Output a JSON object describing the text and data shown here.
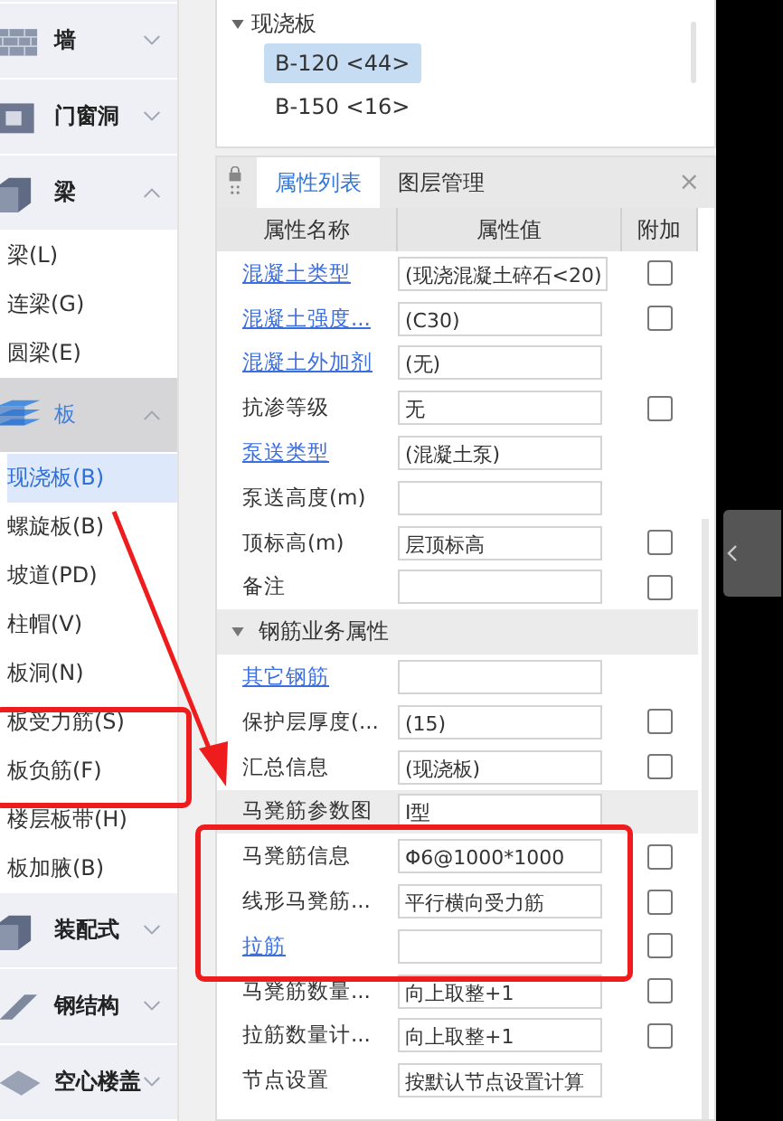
{
  "sidebar": {
    "groups": [
      {
        "label": "墙",
        "expanded": false,
        "selected": false
      },
      {
        "label": "门窗洞",
        "expanded": false,
        "selected": false
      },
      {
        "label": "梁",
        "expanded": true,
        "selected": false,
        "children": [
          {
            "label": "梁(L)",
            "selected": false
          },
          {
            "label": "连梁(G)",
            "selected": false
          },
          {
            "label": "圆梁(E)",
            "selected": false
          }
        ]
      },
      {
        "label": "板",
        "expanded": true,
        "selected": true,
        "children": [
          {
            "label": "现浇板(B)",
            "selected": true
          },
          {
            "label": "螺旋板(B)",
            "selected": false
          },
          {
            "label": "坡道(PD)",
            "selected": false
          },
          {
            "label": "柱帽(V)",
            "selected": false
          },
          {
            "label": "板洞(N)",
            "selected": false
          },
          {
            "label": "板受力筋(S)",
            "selected": false
          },
          {
            "label": "板负筋(F)",
            "selected": false
          },
          {
            "label": "楼层板带(H)",
            "selected": false
          },
          {
            "label": "板加腋(B)",
            "selected": false
          }
        ]
      },
      {
        "label": "装配式",
        "expanded": false,
        "selected": false
      },
      {
        "label": "钢结构",
        "expanded": false,
        "selected": false
      },
      {
        "label": "空心楼盖",
        "expanded": false,
        "selected": false
      }
    ]
  },
  "tree": {
    "label": "现浇板",
    "expanded": true,
    "items": [
      {
        "label": "B-120 <44>",
        "selected": true
      },
      {
        "label": "B-150 <16>",
        "selected": false
      }
    ]
  },
  "tabs": [
    {
      "label": "属性列表",
      "selected": true
    },
    {
      "label": "图层管理",
      "selected": false
    }
  ],
  "close": "×",
  "table": {
    "columns": [
      "属性名称",
      "属性值",
      "附加"
    ],
    "rows": [
      {
        "kind": "prop",
        "name": "混凝土类型",
        "public": true,
        "value": "(现浇混凝土碎石<20)",
        "checked": false,
        "selected": false
      },
      {
        "kind": "prop",
        "name": "混凝土强度...",
        "public": true,
        "value": "(C30)",
        "checked": false,
        "selected": false
      },
      {
        "kind": "prop",
        "name": "混凝土外加剂",
        "public": true,
        "value": "(无)",
        "selected": false
      },
      {
        "kind": "prop",
        "name": "抗渗等级",
        "public": false,
        "value": "无",
        "checked": false,
        "selected": false
      },
      {
        "kind": "prop",
        "name": "泵送类型",
        "public": true,
        "value": "(混凝土泵)",
        "selected": false
      },
      {
        "kind": "prop",
        "name": "泵送高度(m)",
        "public": false,
        "value": "",
        "selected": false
      },
      {
        "kind": "prop",
        "name": "顶标高(m)",
        "public": false,
        "value": "层顶标高",
        "checked": false,
        "selected": false
      },
      {
        "kind": "prop",
        "name": "备注",
        "public": false,
        "value": "",
        "checked": false,
        "selected": false
      },
      {
        "kind": "section",
        "name": "钢筋业务属性",
        "expanded": true
      },
      {
        "kind": "prop",
        "name": "其它钢筋",
        "public": true,
        "value": "",
        "selected": false
      },
      {
        "kind": "prop",
        "name": "保护层厚度(...",
        "public": false,
        "value": "(15)",
        "checked": false,
        "selected": false
      },
      {
        "kind": "prop",
        "name": "汇总信息",
        "public": false,
        "value": "(现浇板)",
        "checked": false,
        "selected": false
      },
      {
        "kind": "prop",
        "name": "马凳筋参数图",
        "public": false,
        "value": "I型",
        "selected": true
      },
      {
        "kind": "prop",
        "name": "马凳筋信息",
        "public": false,
        "value": "Φ6@1000*1000",
        "checked": false,
        "selected": false
      },
      {
        "kind": "prop",
        "name": "线形马凳筋...",
        "public": false,
        "value": "平行横向受力筋",
        "checked": false,
        "selected": false
      },
      {
        "kind": "prop",
        "name": "拉筋",
        "public": true,
        "value": "",
        "checked": false,
        "selected": false
      },
      {
        "kind": "prop",
        "name": "马凳筋数量...",
        "public": false,
        "value": "向上取整+1",
        "checked": false,
        "selected": false
      },
      {
        "kind": "prop",
        "name": "拉筋数量计...",
        "public": false,
        "value": "向上取整+1",
        "checked": false,
        "selected": false
      },
      {
        "kind": "prop",
        "name": "节点设置",
        "public": false,
        "value": "按默认节点设置计算",
        "selected": false
      }
    ]
  }
}
